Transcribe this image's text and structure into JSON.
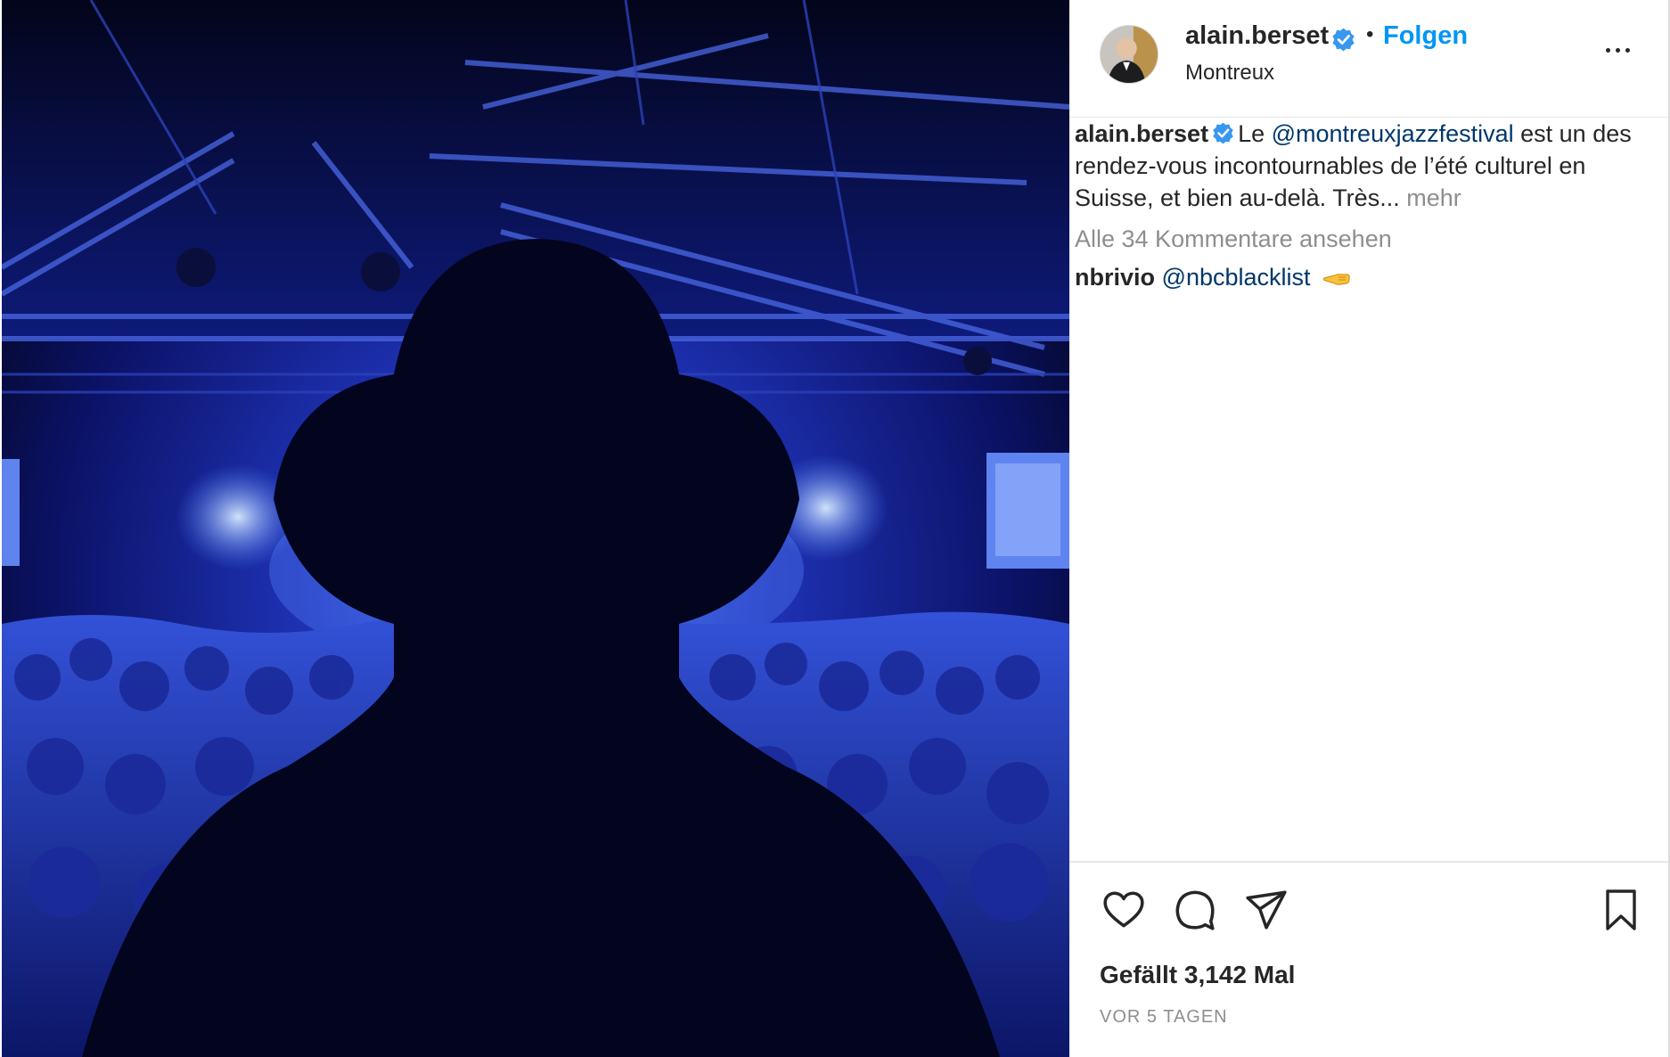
{
  "post": {
    "photo_alt": "",
    "header": {
      "username": "alain.berset",
      "separator": "•",
      "follow_label": "Folgen",
      "location": "Montreux"
    },
    "caption": {
      "username": "alain.berset",
      "text_before": "Le ",
      "mention": "@montreuxjazzfestival",
      "text_after": " est un des rendez-vous incontournables de l’été culturel en Suisse, et bien au-delà. Très...",
      "more_label": "mehr"
    },
    "view_comments_label": "Alle 34 Kommentare ansehen",
    "comments": [
      {
        "username": "nbrivio",
        "mention": "@nbcblacklist",
        "emoji": "backhand-index-pointing-left"
      }
    ],
    "likes_label": "Gefällt 3,142 Mal",
    "time_ago": "VOR 5 TAGEN"
  },
  "colors": {
    "accent": "#0095f6",
    "mention": "#00376b",
    "secondary_text": "#8e8e8e",
    "primary_text": "#262626",
    "verified": "#3897f0"
  },
  "icons": {
    "verified": "verified-badge-icon",
    "more": "more-horizontal-icon",
    "like": "heart-icon",
    "comment": "comment-bubble-icon",
    "share": "paper-plane-icon",
    "save": "bookmark-icon"
  }
}
